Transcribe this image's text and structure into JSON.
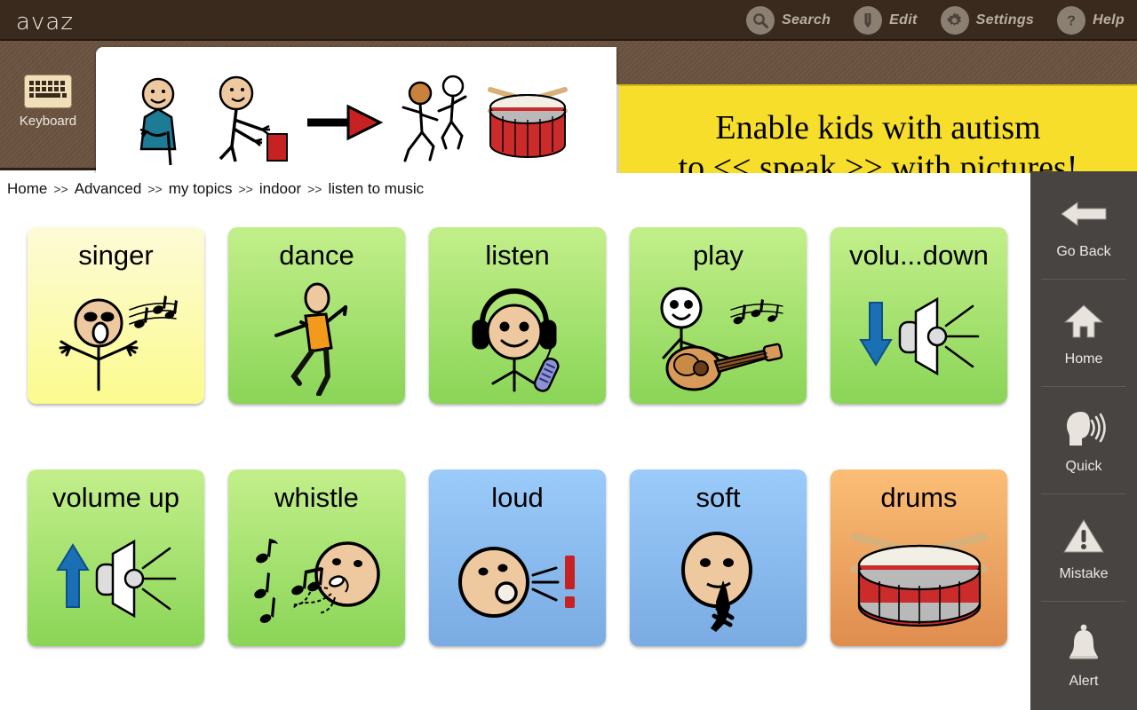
{
  "app": {
    "brand": "avaz"
  },
  "toolbar": [
    {
      "id": "search",
      "label": "Search",
      "icon": "search-icon"
    },
    {
      "id": "edit",
      "label": "Edit",
      "icon": "pencil-icon"
    },
    {
      "id": "settings",
      "label": "Settings",
      "icon": "gear-icon"
    },
    {
      "id": "help",
      "label": "Help",
      "icon": "question-mark-icon"
    }
  ],
  "keyboard": {
    "label": "Keyboard",
    "icon": "keyboard-icon"
  },
  "sentence": {
    "words": [
      {
        "text": "I",
        "icon": "person-pointing-self-pictogram"
      },
      {
        "text": "want",
        "icon": "person-reaching-for-block-pictogram"
      },
      {
        "text": "to",
        "icon": "right-arrow-pictogram"
      },
      {
        "text": "play",
        "icon": "two-children-running-pictogram"
      },
      {
        "text": "drums",
        "icon": "snare-drum-pictogram"
      }
    ]
  },
  "promo": {
    "line1": "Enable kids with autism",
    "line2": "to << speak >> with pictures!"
  },
  "breadcrumb": {
    "separator": ">>",
    "items": [
      "Home",
      "Advanced",
      "my topics",
      "indoor",
      "listen to music"
    ]
  },
  "scroll": {
    "up": "scroll-up-arrow",
    "up_state": "disabled",
    "down": "scroll-down-arrow",
    "down_state": "enabled"
  },
  "grid": {
    "tiles": [
      {
        "label": "singer",
        "color_class": "c-yellow",
        "color": "#fbfb8e",
        "icon": "singing-person-pictogram"
      },
      {
        "label": "dance",
        "color_class": "c-green",
        "color": "#8ad557",
        "icon": "dancing-person-pictogram"
      },
      {
        "label": "listen",
        "color_class": "c-green",
        "color": "#8ad557",
        "icon": "person-with-headphones-pictogram"
      },
      {
        "label": "play",
        "color_class": "c-green",
        "color": "#8ad557",
        "icon": "person-playing-guitar-pictogram"
      },
      {
        "label": "volu...down",
        "color_class": "c-green",
        "color": "#8ad557",
        "icon": "volume-down-speaker-pictogram"
      },
      {
        "label": "volume up",
        "color_class": "c-green",
        "color": "#8ad557",
        "icon": "volume-up-speaker-pictogram"
      },
      {
        "label": "whistle",
        "color_class": "c-green",
        "color": "#8ad557",
        "icon": "whistling-face-pictogram"
      },
      {
        "label": "loud",
        "color_class": "c-blue",
        "color": "#7aabe2",
        "icon": "shouting-face-pictogram"
      },
      {
        "label": "soft",
        "color_class": "c-blue",
        "color": "#7aabe2",
        "icon": "quiet-face-finger-on-lips-pictogram"
      },
      {
        "label": "drums",
        "color_class": "c-orange",
        "color": "#df8d4f",
        "icon": "snare-drum-pictogram"
      }
    ]
  },
  "sidebar": {
    "items": [
      {
        "label": "Go Back",
        "icon": "back-arrow-icon"
      },
      {
        "label": "Home",
        "icon": "home-icon"
      },
      {
        "label": "Quick",
        "icon": "speaking-head-icon"
      },
      {
        "label": "Mistake",
        "icon": "warning-triangle-icon"
      },
      {
        "label": "Alert",
        "icon": "bell-icon"
      }
    ]
  },
  "colors": {
    "topbar": "#3a2a1e",
    "band": "#6b5240",
    "promo_bg": "#f6de2a",
    "sidebar_bg": "#474442"
  }
}
